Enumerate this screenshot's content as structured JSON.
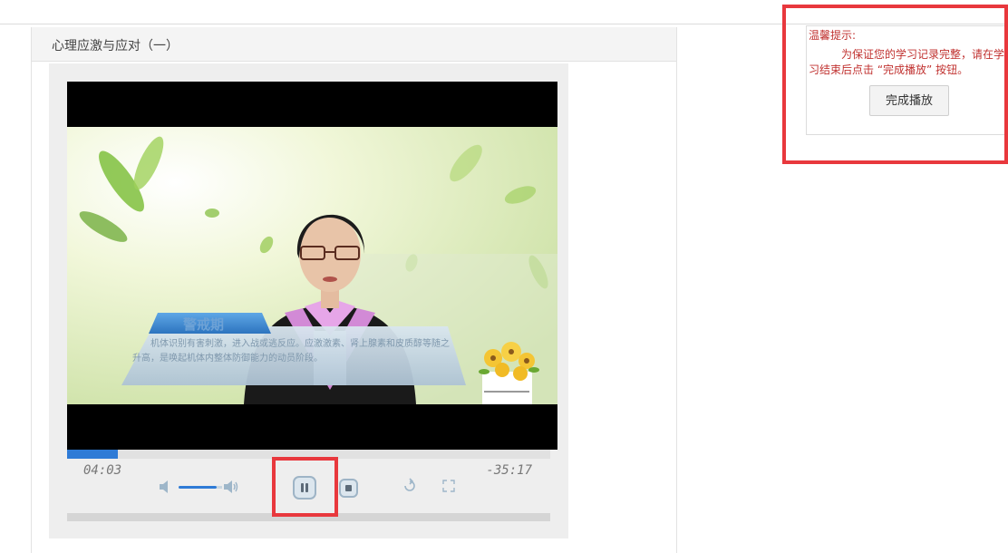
{
  "course": {
    "title": "心理应激与应对（一）"
  },
  "player": {
    "elapsed": "04:03",
    "remaining": "-35:17",
    "progress_fraction": 0.105,
    "volume_fraction": 0.85,
    "state": "playing"
  },
  "video_overlay": {
    "stage_label": "警戒期",
    "caption": "机体识别有害刺激，进入战或逃反应。应激激素、肾上腺素和皮质醇等随之升高，是唤起机体内整体防御能力的动员阶段。"
  },
  "tip": {
    "title": "温馨提示:",
    "message": "为保证您的学习记录完整，请在学习结束后点击 “完成播放” 按钮。",
    "button_label": "完成播放"
  },
  "colors": {
    "accent": "#2f7bd6",
    "highlight": "#e8383d",
    "tip_text": "#c0312f"
  },
  "icons": [
    "volume-mute-icon",
    "volume-max-icon",
    "pause-icon",
    "stop-icon",
    "replay-icon",
    "fullscreen-icon"
  ]
}
